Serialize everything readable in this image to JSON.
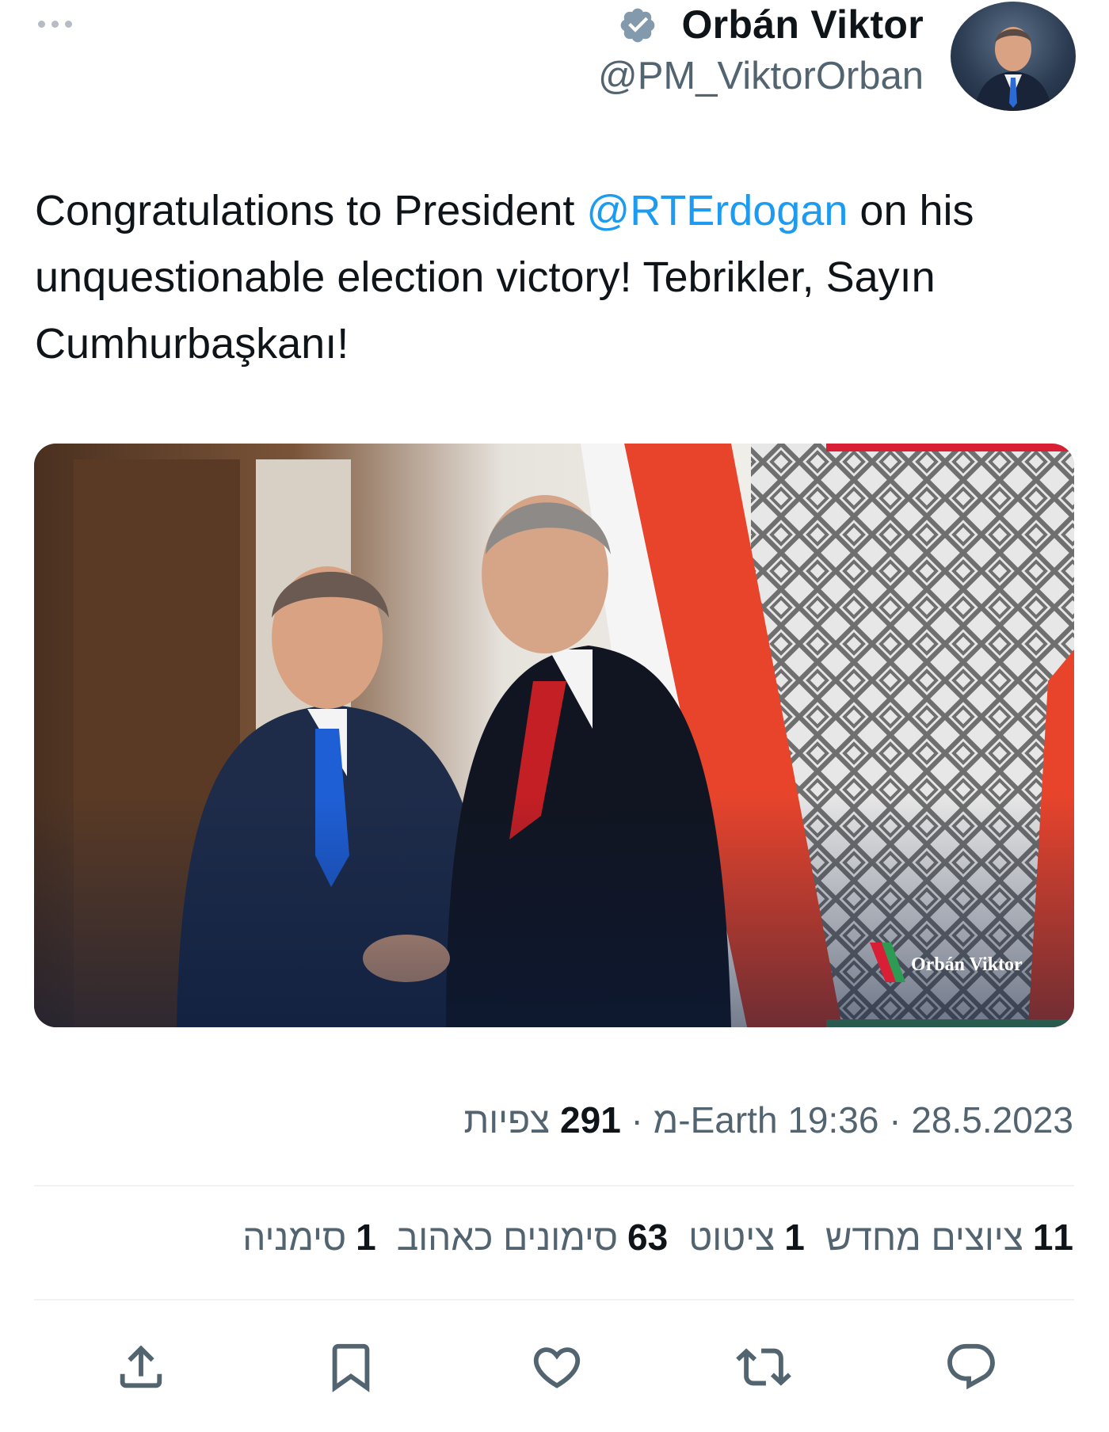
{
  "author": {
    "display_name": "Orbán Viktor",
    "handle": "@PM_ViktorOrban",
    "verified_icon": "verified-badge-icon",
    "avatar_icon": "avatar"
  },
  "tweet": {
    "text_before": "Congratulations to President ",
    "mention": "@RTErdogan",
    "text_after": " on his unquestionable election victory! Tebrikler, Sayın Cumhurbaşkanı!"
  },
  "media": {
    "watermark": "Orbán Viktor"
  },
  "meta": {
    "date": "28.5.2023",
    "time": "19:36",
    "source": "Earth-מ",
    "views_count": "291",
    "views_label": "צפיות"
  },
  "stats": {
    "retweets": {
      "count": "11",
      "label": "ציוצים מחדש"
    },
    "quotes": {
      "count": "1",
      "label": "ציטוט"
    },
    "likes": {
      "count": "63",
      "label": "סימונים כאהוב"
    },
    "bookmarks": {
      "count": "1",
      "label": "סימניה"
    }
  },
  "actions": [
    "share-icon",
    "bookmark-icon",
    "heart-icon",
    "retweet-icon",
    "reply-icon"
  ],
  "colors": {
    "accent": "#1d9bf0",
    "text": "#0f1419",
    "muted": "#536471",
    "divider": "#eff3f4"
  }
}
